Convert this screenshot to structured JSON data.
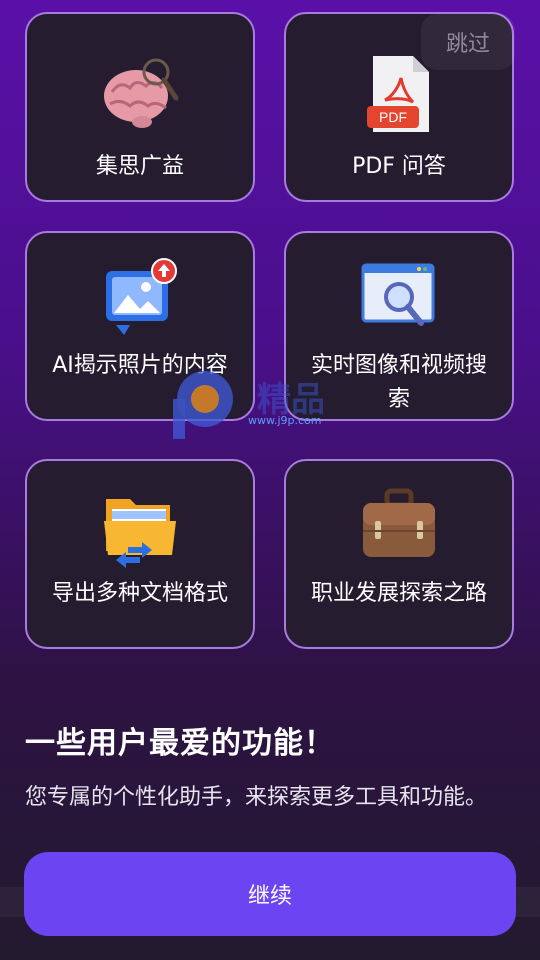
{
  "skip_label": "跳过",
  "cards": [
    {
      "label": "集思广益",
      "icon": "brain-magnifier-icon"
    },
    {
      "label": "PDF 问答",
      "icon": "pdf-file-icon"
    },
    {
      "label": "AI揭示照片的内容",
      "icon": "image-upload-icon"
    },
    {
      "label": "实时图像和视频搜索",
      "icon": "window-search-icon"
    },
    {
      "label": "导出多种文档格式",
      "icon": "folder-transfer-icon"
    },
    {
      "label": "职业发展探索之路",
      "icon": "briefcase-icon"
    }
  ],
  "pdf_badge": "PDF",
  "watermark_url": "www.j9p.com",
  "headline": "一些用户最爱的功能！",
  "description": "您专属的个性化助手，来探索更多工具和功能。",
  "continue_label": "继续",
  "colors": {
    "accent": "#6d44f2",
    "card_border": "#a87be0",
    "card_bg": "#251c2f"
  }
}
